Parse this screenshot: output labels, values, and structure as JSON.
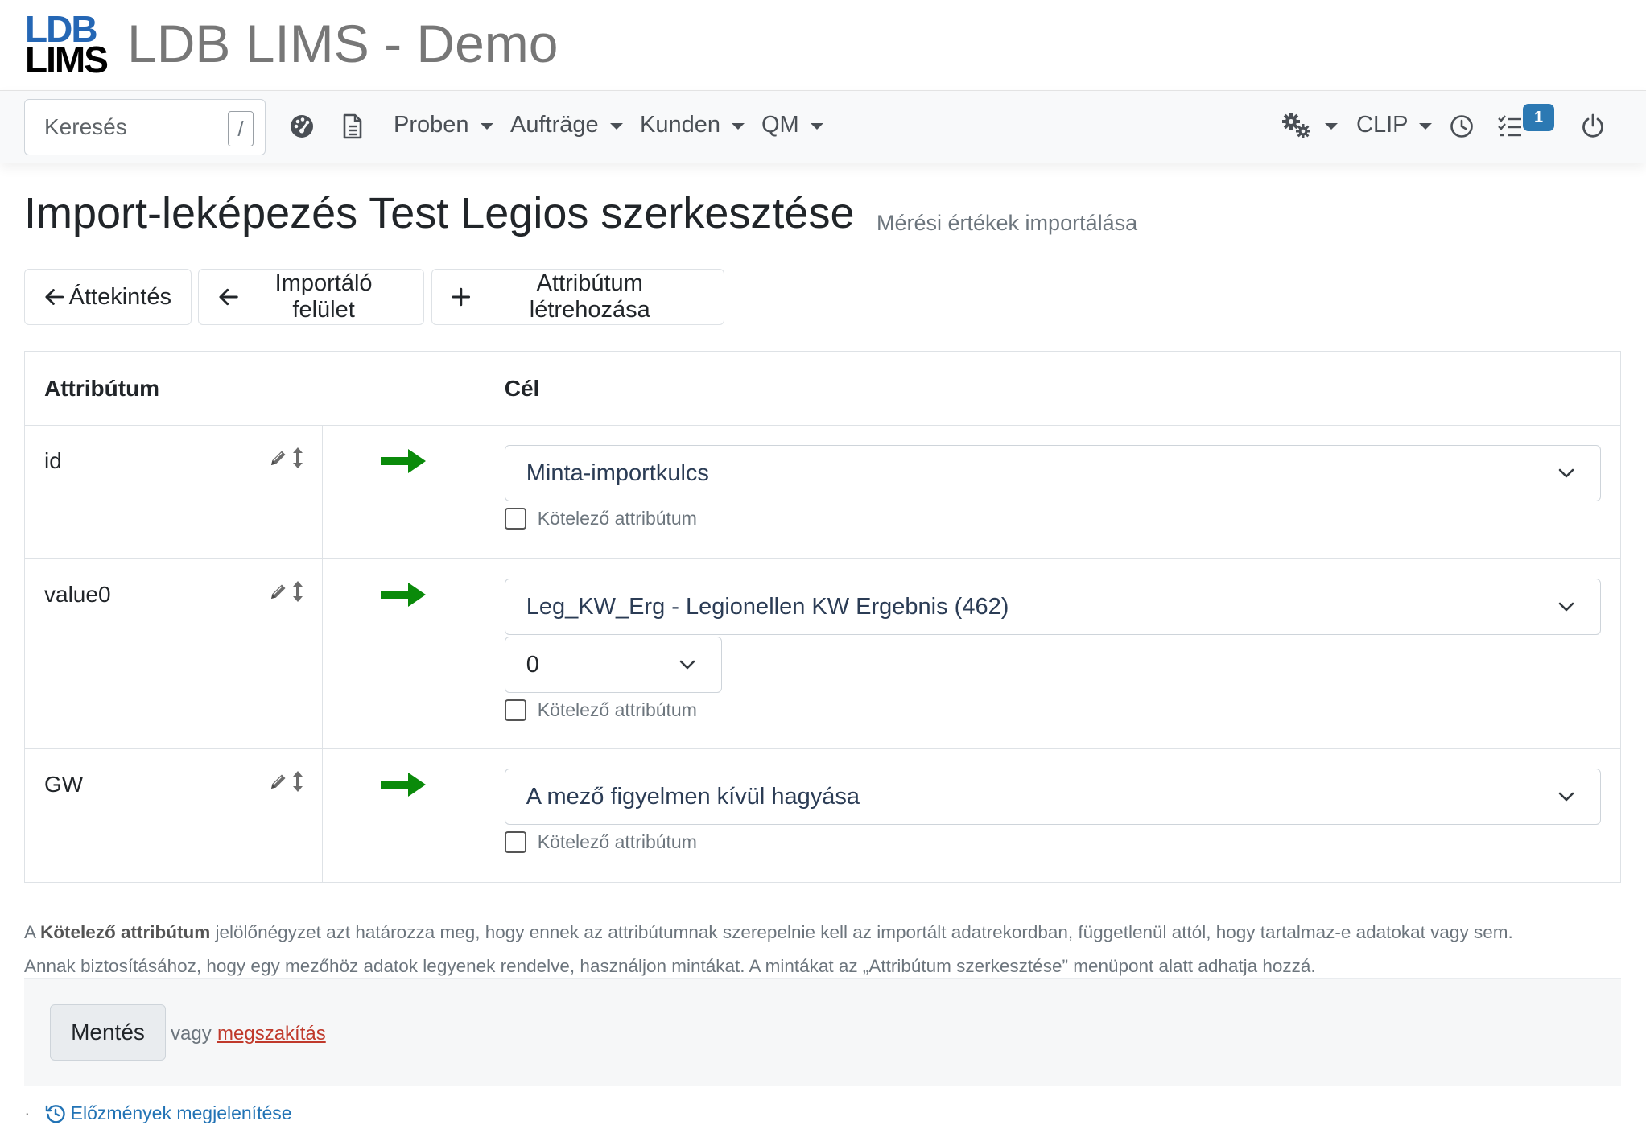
{
  "app": {
    "logo_line1": "LDB",
    "logo_line2": "LIMS",
    "title": "LDB LIMS - Demo"
  },
  "navbar": {
    "search_placeholder": "Keresés",
    "search_shortcut": "/",
    "menus": [
      {
        "label": "Proben"
      },
      {
        "label": "Aufträge"
      },
      {
        "label": "Kunden"
      },
      {
        "label": "QM"
      }
    ],
    "clip_label": "CLIP",
    "tasks_badge": "1",
    "icons": [
      "dashboard-icon",
      "document-icon",
      "settings-gears-icon",
      "clock-icon",
      "tasks-icon",
      "power-icon"
    ]
  },
  "page": {
    "title": "Import-leképezés Test Legios szerkesztése",
    "subtitle": "Mérési értékek importálása"
  },
  "actions": {
    "overview": "Áttekintés",
    "import_view": "Importáló felület",
    "create_attribute": "Attribútum létrehozása"
  },
  "table": {
    "col_attribute": "Attribútum",
    "col_target": "Cél",
    "required_label": "Kötelező attribútum",
    "rows": [
      {
        "name": "id",
        "target": "Minta-importkulcs",
        "sub_select": null,
        "required": false
      },
      {
        "name": "value0",
        "target": "Leg_KW_Erg - Legionellen KW Ergebnis (462)",
        "sub_select": "0",
        "required": false
      },
      {
        "name": "GW",
        "target": "A mező figyelmen kívül hagyása",
        "sub_select": null,
        "required": false
      }
    ]
  },
  "help": {
    "prefix": "A ",
    "bold": "Kötelező attribútum",
    "line1_rest": " jelölőnégyzet azt határozza meg, hogy ennek az attribútumnak szerepelnie kell az importált adatrekordban, függetlenül attól, hogy tartalmaz-e adatokat vagy sem.",
    "line2": "Annak biztosításához, hogy egy mezőhöz adatok legyenek rendelve, használjon mintákat. A mintákat az „Attribútum szerkesztése” menüpont alatt adhatja hozzá."
  },
  "footer": {
    "save": "Mentés",
    "or": "vagy",
    "cancel": "megszakítás",
    "history": "Előzmények megjelenítése",
    "history_bullet": "·"
  },
  "colors": {
    "brand_blue": "#2567b5",
    "arrow_green": "#0a8a0a",
    "badge_blue": "#2c79b3",
    "link_blue": "#2273b5",
    "cancel_red": "#c0392b"
  }
}
